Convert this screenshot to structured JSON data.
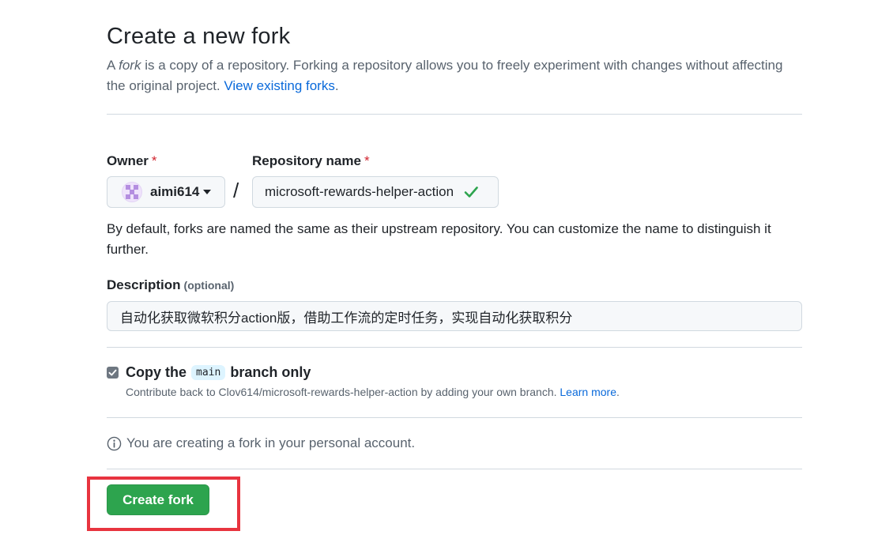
{
  "page": {
    "title": "Create a new fork",
    "intro_a": "A ",
    "intro_fork": "fork",
    "intro_b": " is a copy of a repository. Forking a repository allows you to freely experiment with changes without affecting the original project. ",
    "intro_link": "View existing forks",
    "intro_end": "."
  },
  "form": {
    "owner_label": "Owner",
    "repo_label": "Repository name",
    "required_mark": "*",
    "owner_value": "aimi614",
    "slash": "/",
    "repo_value": "microsoft-rewards-helper-action",
    "name_help": "By default, forks are named the same as their upstream repository. You can customize the name to distinguish it further.",
    "description_label": "Description",
    "description_optional": "(optional)",
    "description_value": "自动化获取微软积分action版，借助工作流的定时任务，实现自动化获取积分",
    "copy_prefix": "Copy the",
    "copy_branch": "main",
    "copy_suffix": "branch only",
    "copy_checked": true,
    "contrib_text": "Contribute back to Clov614/microsoft-rewards-helper-action by adding your own branch. ",
    "learn_more": "Learn more",
    "learn_more_end": ".",
    "info_text": "You are creating a fork in your personal account.",
    "create_button": "Create fork"
  },
  "icons": {
    "check": "check-icon",
    "info": "info-icon",
    "caret": "chevron-down-icon",
    "checkbox": "checkbox-checked-icon"
  },
  "colors": {
    "primary_button": "#2da44e",
    "link": "#0969da",
    "required": "#d1242f",
    "highlight_box": "#e8343f",
    "success_check": "#2da44e"
  }
}
